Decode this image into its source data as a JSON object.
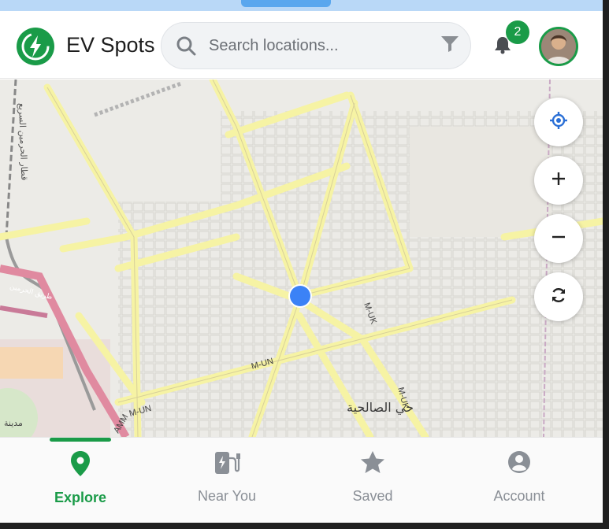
{
  "app": {
    "title": "EV Spots",
    "logo_icon": "bolt-icon"
  },
  "search": {
    "placeholder": "Search locations...",
    "value": "",
    "search_icon": "search-icon",
    "filter_icon": "filter-icon"
  },
  "notifications": {
    "count": "2",
    "icon": "bell-icon"
  },
  "user": {
    "avatar": "avatar"
  },
  "map": {
    "labels": {
      "district": "حي الصالحية",
      "road1": "M-UN",
      "road2": "M-UK",
      "road3": "M-UN",
      "road4": "M-UK",
      "road5": "AMM",
      "railway": "قطار الحرمين السريع",
      "city": "مدينة",
      "highway": "طريق الحرمين"
    },
    "controls": [
      "locate-icon",
      "zoom-in-icon",
      "zoom-out-icon",
      "refresh-icon"
    ]
  },
  "nav": {
    "items": [
      {
        "label": "Explore",
        "icon": "map-pin-icon",
        "active": true
      },
      {
        "label": "Near You",
        "icon": "ev-charger-icon",
        "active": false
      },
      {
        "label": "Saved",
        "icon": "star-icon",
        "active": false
      },
      {
        "label": "Account",
        "icon": "account-icon",
        "active": false
      }
    ]
  },
  "colors": {
    "accent": "#1a9b48",
    "location_dot": "#3b82f6",
    "road": "#f6f3a4"
  }
}
